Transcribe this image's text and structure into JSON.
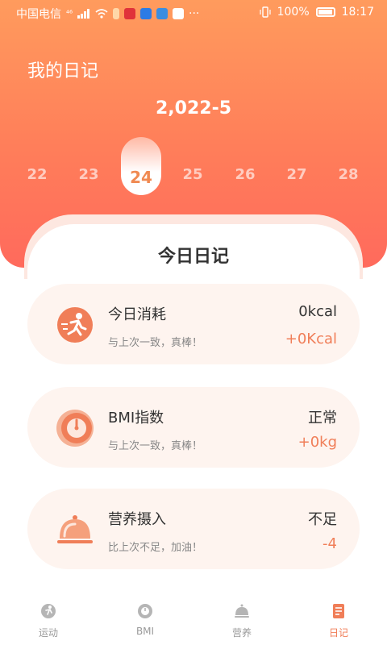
{
  "status_bar": {
    "carrier": "中国电信",
    "network": "⁴⁶",
    "battery": "100%",
    "time": "18:17",
    "more": "···"
  },
  "header": {
    "title": "我的日记",
    "month": "2,022-5"
  },
  "days": [
    "22",
    "23",
    "24",
    "25",
    "26",
    "27",
    "28"
  ],
  "selected_day": "24",
  "panel": {
    "title": "今日日记"
  },
  "cards": [
    {
      "name": "今日消耗",
      "desc": "与上次一致，真棒！",
      "value": "0kcal",
      "delta": "+0Kcal",
      "icon": "running-icon"
    },
    {
      "name": "BMI指数",
      "desc": "与上次一致，真棒！",
      "value": "正常",
      "delta": "+0kg",
      "icon": "scale-icon"
    },
    {
      "name": "营养摄入",
      "desc": "比上次不足，加油！",
      "value": "不足",
      "delta": "-4",
      "icon": "food-cover-icon"
    }
  ],
  "tabs": [
    {
      "label": "运动",
      "icon": "sport-icon",
      "active": false
    },
    {
      "label": "BMI",
      "icon": "bmi-icon",
      "active": false
    },
    {
      "label": "营养",
      "icon": "nutrition-icon",
      "active": false
    },
    {
      "label": "日记",
      "icon": "diary-icon",
      "active": true
    }
  ],
  "colors": {
    "accent": "#f07e58",
    "header_top": "#ff9b5d",
    "header_bottom": "#ff6a5c",
    "card_bg": "#fef4ef"
  }
}
